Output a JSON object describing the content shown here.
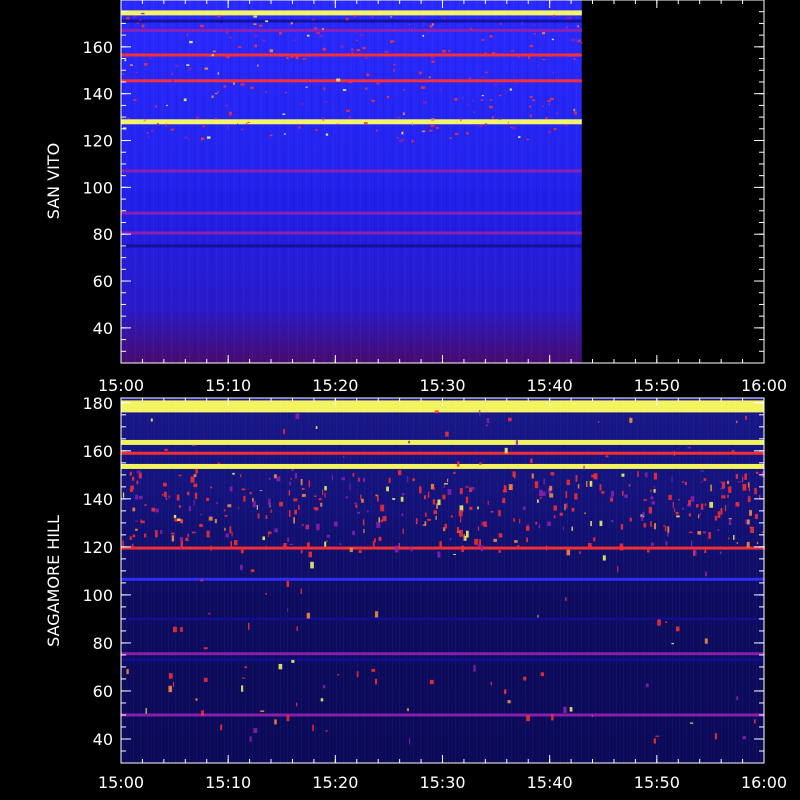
{
  "chart_data": [
    {
      "type": "heatmap",
      "ylabel": "SAN VITO",
      "xlim": [
        "15:00",
        "16:00"
      ],
      "ylim": [
        25,
        180
      ],
      "x_ticks": [
        "15:00",
        "15:10",
        "15:20",
        "15:30",
        "15:40",
        "15:50",
        "16:00"
      ],
      "y_ticks": [
        40,
        60,
        80,
        100,
        120,
        140,
        160
      ],
      "data_end_time": "15:43",
      "bands": [
        {
          "freq": 174.5,
          "level": "yellow"
        },
        {
          "freq": 171,
          "level": "blue-dark"
        },
        {
          "freq": 167,
          "level": "purple"
        },
        {
          "freq": 156.5,
          "level": "red"
        },
        {
          "freq": 145.5,
          "level": "red"
        },
        {
          "freq": 128,
          "level": "yellow"
        },
        {
          "freq": 107,
          "level": "purple"
        },
        {
          "freq": 89,
          "level": "purple"
        },
        {
          "freq": 80.5,
          "level": "purple"
        },
        {
          "freq": 75,
          "level": "blue-dark"
        }
      ],
      "base_color_top": "#1f1fff",
      "base_color_bottom": "#4a0a6a"
    },
    {
      "type": "heatmap",
      "ylabel": "SAGAMORE HILL",
      "xlim": [
        "15:00",
        "16:00"
      ],
      "ylim": [
        30,
        182
      ],
      "x_ticks": [
        "15:00",
        "15:10",
        "15:20",
        "15:30",
        "15:40",
        "15:50",
        "16:00"
      ],
      "y_ticks": [
        40,
        60,
        80,
        100,
        120,
        140,
        160,
        180
      ],
      "data_end_time": "16:00",
      "bands": [
        {
          "freq": 178.5,
          "level": "yellow"
        },
        {
          "freq": 163.5,
          "level": "yellow"
        },
        {
          "freq": 159,
          "level": "red"
        },
        {
          "freq": 153.5,
          "level": "yellow"
        },
        {
          "freq": 119.5,
          "level": "red"
        },
        {
          "freq": 106.5,
          "level": "blue"
        },
        {
          "freq": 90,
          "level": "blue-dark"
        },
        {
          "freq": 75.5,
          "level": "purple"
        },
        {
          "freq": 73,
          "level": "blue-dark"
        },
        {
          "freq": 50,
          "level": "purple"
        }
      ],
      "base_color_top": "#10106a",
      "base_color_bottom": "#0a0a50"
    }
  ],
  "colors": {
    "background": "#000000",
    "axis": "#ffffff",
    "yellow": "#ffff60",
    "red": "#ff3030",
    "purple": "#9020b0",
    "blue": "#3030ff",
    "blue-dark": "#101090"
  }
}
